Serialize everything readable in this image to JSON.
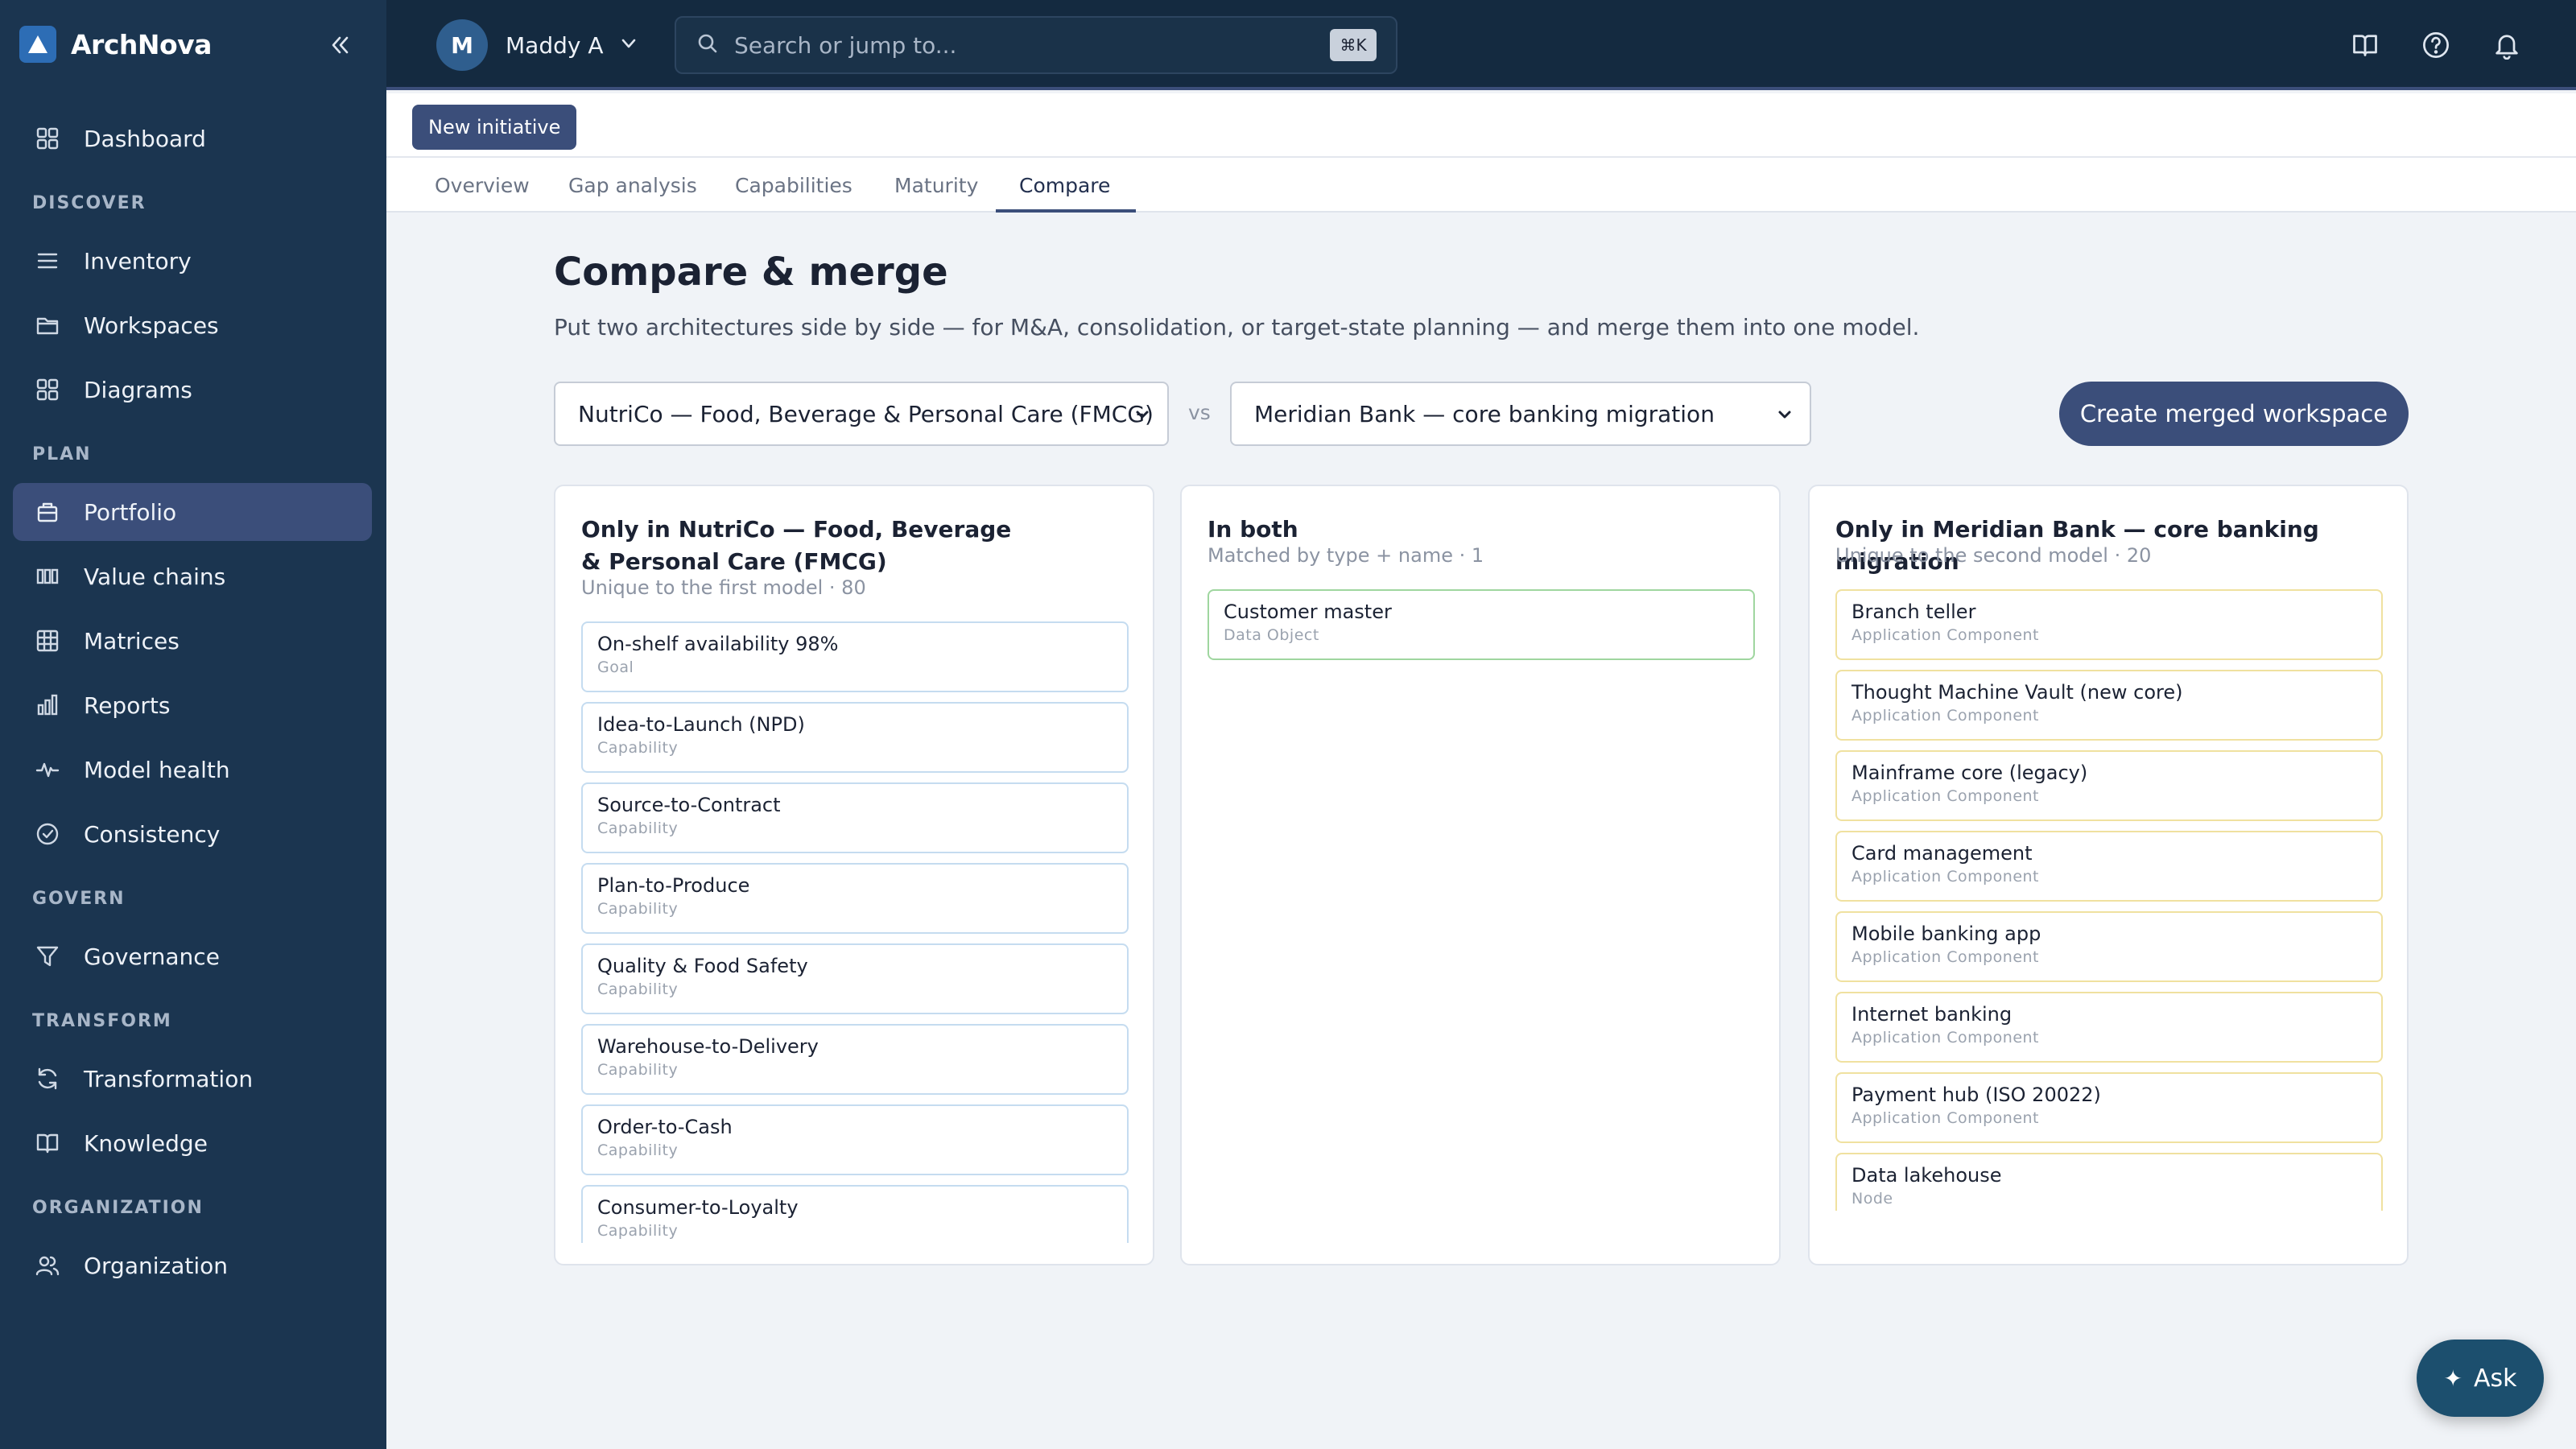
{
  "app": {
    "name": "ArchNova",
    "user_initial": "M",
    "user_name": "Maddy A",
    "search_placeholder": "Search or jump to...",
    "search_shortcut": "⌘K"
  },
  "sidebar": {
    "dashboard": "Dashboard",
    "sections": {
      "discover": "DISCOVER",
      "plan": "PLAN",
      "govern": "GOVERN",
      "transform": "TRANSFORM",
      "organization": "ORGANIZATION"
    },
    "items": {
      "inventory": "Inventory",
      "workspaces": "Workspaces",
      "diagrams": "Diagrams",
      "portfolio": "Portfolio",
      "value_chains": "Value chains",
      "matrices": "Matrices",
      "reports": "Reports",
      "model_health": "Model health",
      "consistency": "Consistency",
      "governance": "Governance",
      "transformation": "Transformation",
      "knowledge": "Knowledge",
      "organization": "Organization"
    },
    "active": "Portfolio"
  },
  "header": {
    "new_initiative": "New initiative",
    "tabs": [
      "Overview",
      "Gap analysis",
      "Capabilities",
      "Maturity",
      "Compare"
    ],
    "active_tab": "Compare"
  },
  "main": {
    "title": "Compare & merge",
    "subtitle": "Put two architectures side by side — for M&A, consolidation, or target-state planning — and merge them into one model.",
    "left_select": "NutriCo — Food, Beverage & Personal Care (FMCG)",
    "vs": "vs",
    "right_select": "Meridian Bank — core banking migration",
    "merge_button": "Create merged workspace"
  },
  "panels": {
    "left": {
      "title": "Only in NutriCo — Food, Beverage & Personal Care (FMCG)",
      "meta": "Unique to the first model · 80",
      "items": [
        {
          "name": "On-shelf availability 98%",
          "type": "Goal"
        },
        {
          "name": "Idea-to-Launch (NPD)",
          "type": "Capability"
        },
        {
          "name": "Source-to-Contract",
          "type": "Capability"
        },
        {
          "name": "Plan-to-Produce",
          "type": "Capability"
        },
        {
          "name": "Quality & Food Safety",
          "type": "Capability"
        },
        {
          "name": "Warehouse-to-Delivery",
          "type": "Capability"
        },
        {
          "name": "Order-to-Cash",
          "type": "Capability"
        },
        {
          "name": "Consumer-to-Loyalty",
          "type": "Capability"
        }
      ]
    },
    "middle": {
      "title": "In both",
      "meta": "Matched by type + name · 1",
      "items": [
        {
          "name": "Customer master",
          "type": "Data Object"
        }
      ]
    },
    "right": {
      "title": "Only in Meridian Bank — core banking migration",
      "meta": "Unique to the second model · 20",
      "items": [
        {
          "name": "Branch teller",
          "type": "Application Component"
        },
        {
          "name": "Thought Machine Vault (new core)",
          "type": "Application Component"
        },
        {
          "name": "Mainframe core (legacy)",
          "type": "Application Component"
        },
        {
          "name": "Card management",
          "type": "Application Component"
        },
        {
          "name": "Mobile banking app",
          "type": "Application Component"
        },
        {
          "name": "Internet banking",
          "type": "Application Component"
        },
        {
          "name": "Payment hub (ISO 20022)",
          "type": "Application Component"
        },
        {
          "name": "Data lakehouse",
          "type": "Node"
        }
      ]
    }
  },
  "ask": {
    "label": "Ask",
    "icon": "sparkle-icon"
  },
  "colors": {
    "sidebar_bg": "#1b3550",
    "topbar_bg": "#142a40",
    "accent": "#3b4e7a",
    "left_border": "#c5dcf0",
    "both_border": "#9fd69f",
    "right_border": "#f0e1a0"
  }
}
